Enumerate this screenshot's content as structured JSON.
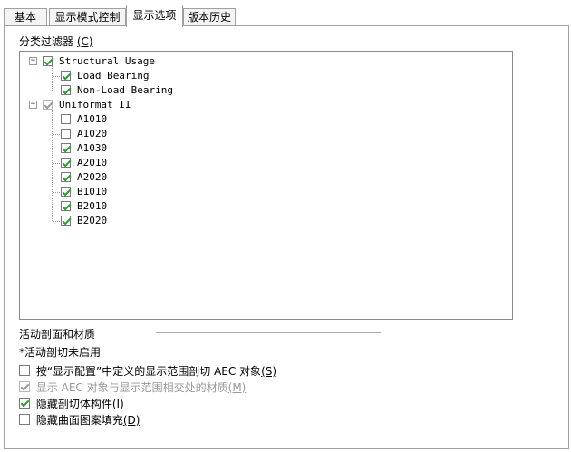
{
  "tabs": [
    "基本",
    "显示模式控制",
    "显示选项",
    "版本历史"
  ],
  "filter": {
    "label": "分类过滤器 ",
    "accel": "(C)",
    "tree": [
      {
        "label": "Structural Usage",
        "checked": true,
        "children": [
          {
            "label": "Load Bearing",
            "checked": true
          },
          {
            "label": "Non-Load Bearing",
            "checked": true
          }
        ]
      },
      {
        "label": "Uniformat II",
        "checked": true,
        "children": [
          {
            "label": "A1010",
            "checked": false
          },
          {
            "label": "A1020",
            "checked": false
          },
          {
            "label": "A1030",
            "checked": true
          },
          {
            "label": "A2010",
            "checked": true
          },
          {
            "label": "A2020",
            "checked": true
          },
          {
            "label": "B1010",
            "checked": true
          },
          {
            "label": "B2010",
            "checked": true
          },
          {
            "label": "B2020",
            "checked": true
          }
        ]
      }
    ]
  },
  "section": {
    "title": "活动剖面和材质",
    "note": "*活动剖切未启用",
    "options": [
      {
        "label": "按“显示配置”中定义的显示范围剖切 AEC 对象",
        "accel": "(S)",
        "checked": false,
        "disabled": false
      },
      {
        "label": "显示 AEC 对象与显示范围相交处的材质",
        "accel": "(M)",
        "checked": true,
        "disabled": true
      },
      {
        "label": "隐藏剖切体构件",
        "accel": "(I)",
        "checked": true,
        "disabled": false
      },
      {
        "label": "隐藏曲面图案填充",
        "accel": "(D)",
        "checked": false,
        "disabled": false
      }
    ]
  },
  "colors": {
    "check": "#2f9e33",
    "border": "#a0a0a0"
  }
}
